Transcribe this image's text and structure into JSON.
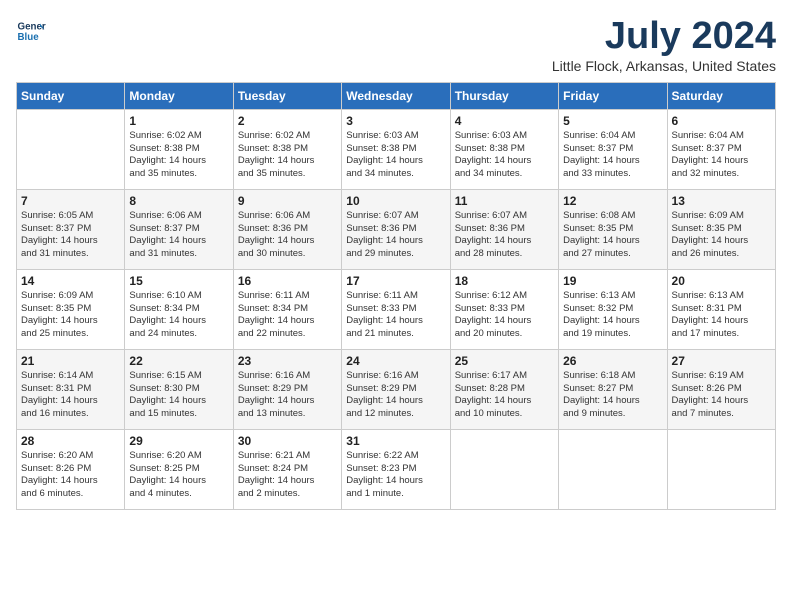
{
  "header": {
    "logo_line1": "General",
    "logo_line2": "Blue",
    "month": "July 2024",
    "location": "Little Flock, Arkansas, United States"
  },
  "weekdays": [
    "Sunday",
    "Monday",
    "Tuesday",
    "Wednesday",
    "Thursday",
    "Friday",
    "Saturday"
  ],
  "weeks": [
    [
      {
        "day": "",
        "info": ""
      },
      {
        "day": "1",
        "info": "Sunrise: 6:02 AM\nSunset: 8:38 PM\nDaylight: 14 hours\nand 35 minutes."
      },
      {
        "day": "2",
        "info": "Sunrise: 6:02 AM\nSunset: 8:38 PM\nDaylight: 14 hours\nand 35 minutes."
      },
      {
        "day": "3",
        "info": "Sunrise: 6:03 AM\nSunset: 8:38 PM\nDaylight: 14 hours\nand 34 minutes."
      },
      {
        "day": "4",
        "info": "Sunrise: 6:03 AM\nSunset: 8:38 PM\nDaylight: 14 hours\nand 34 minutes."
      },
      {
        "day": "5",
        "info": "Sunrise: 6:04 AM\nSunset: 8:37 PM\nDaylight: 14 hours\nand 33 minutes."
      },
      {
        "day": "6",
        "info": "Sunrise: 6:04 AM\nSunset: 8:37 PM\nDaylight: 14 hours\nand 32 minutes."
      }
    ],
    [
      {
        "day": "7",
        "info": "Sunrise: 6:05 AM\nSunset: 8:37 PM\nDaylight: 14 hours\nand 31 minutes."
      },
      {
        "day": "8",
        "info": "Sunrise: 6:06 AM\nSunset: 8:37 PM\nDaylight: 14 hours\nand 31 minutes."
      },
      {
        "day": "9",
        "info": "Sunrise: 6:06 AM\nSunset: 8:36 PM\nDaylight: 14 hours\nand 30 minutes."
      },
      {
        "day": "10",
        "info": "Sunrise: 6:07 AM\nSunset: 8:36 PM\nDaylight: 14 hours\nand 29 minutes."
      },
      {
        "day": "11",
        "info": "Sunrise: 6:07 AM\nSunset: 8:36 PM\nDaylight: 14 hours\nand 28 minutes."
      },
      {
        "day": "12",
        "info": "Sunrise: 6:08 AM\nSunset: 8:35 PM\nDaylight: 14 hours\nand 27 minutes."
      },
      {
        "day": "13",
        "info": "Sunrise: 6:09 AM\nSunset: 8:35 PM\nDaylight: 14 hours\nand 26 minutes."
      }
    ],
    [
      {
        "day": "14",
        "info": "Sunrise: 6:09 AM\nSunset: 8:35 PM\nDaylight: 14 hours\nand 25 minutes."
      },
      {
        "day": "15",
        "info": "Sunrise: 6:10 AM\nSunset: 8:34 PM\nDaylight: 14 hours\nand 24 minutes."
      },
      {
        "day": "16",
        "info": "Sunrise: 6:11 AM\nSunset: 8:34 PM\nDaylight: 14 hours\nand 22 minutes."
      },
      {
        "day": "17",
        "info": "Sunrise: 6:11 AM\nSunset: 8:33 PM\nDaylight: 14 hours\nand 21 minutes."
      },
      {
        "day": "18",
        "info": "Sunrise: 6:12 AM\nSunset: 8:33 PM\nDaylight: 14 hours\nand 20 minutes."
      },
      {
        "day": "19",
        "info": "Sunrise: 6:13 AM\nSunset: 8:32 PM\nDaylight: 14 hours\nand 19 minutes."
      },
      {
        "day": "20",
        "info": "Sunrise: 6:13 AM\nSunset: 8:31 PM\nDaylight: 14 hours\nand 17 minutes."
      }
    ],
    [
      {
        "day": "21",
        "info": "Sunrise: 6:14 AM\nSunset: 8:31 PM\nDaylight: 14 hours\nand 16 minutes."
      },
      {
        "day": "22",
        "info": "Sunrise: 6:15 AM\nSunset: 8:30 PM\nDaylight: 14 hours\nand 15 minutes."
      },
      {
        "day": "23",
        "info": "Sunrise: 6:16 AM\nSunset: 8:29 PM\nDaylight: 14 hours\nand 13 minutes."
      },
      {
        "day": "24",
        "info": "Sunrise: 6:16 AM\nSunset: 8:29 PM\nDaylight: 14 hours\nand 12 minutes."
      },
      {
        "day": "25",
        "info": "Sunrise: 6:17 AM\nSunset: 8:28 PM\nDaylight: 14 hours\nand 10 minutes."
      },
      {
        "day": "26",
        "info": "Sunrise: 6:18 AM\nSunset: 8:27 PM\nDaylight: 14 hours\nand 9 minutes."
      },
      {
        "day": "27",
        "info": "Sunrise: 6:19 AM\nSunset: 8:26 PM\nDaylight: 14 hours\nand 7 minutes."
      }
    ],
    [
      {
        "day": "28",
        "info": "Sunrise: 6:20 AM\nSunset: 8:26 PM\nDaylight: 14 hours\nand 6 minutes."
      },
      {
        "day": "29",
        "info": "Sunrise: 6:20 AM\nSunset: 8:25 PM\nDaylight: 14 hours\nand 4 minutes."
      },
      {
        "day": "30",
        "info": "Sunrise: 6:21 AM\nSunset: 8:24 PM\nDaylight: 14 hours\nand 2 minutes."
      },
      {
        "day": "31",
        "info": "Sunrise: 6:22 AM\nSunset: 8:23 PM\nDaylight: 14 hours\nand 1 minute."
      },
      {
        "day": "",
        "info": ""
      },
      {
        "day": "",
        "info": ""
      },
      {
        "day": "",
        "info": ""
      }
    ]
  ]
}
